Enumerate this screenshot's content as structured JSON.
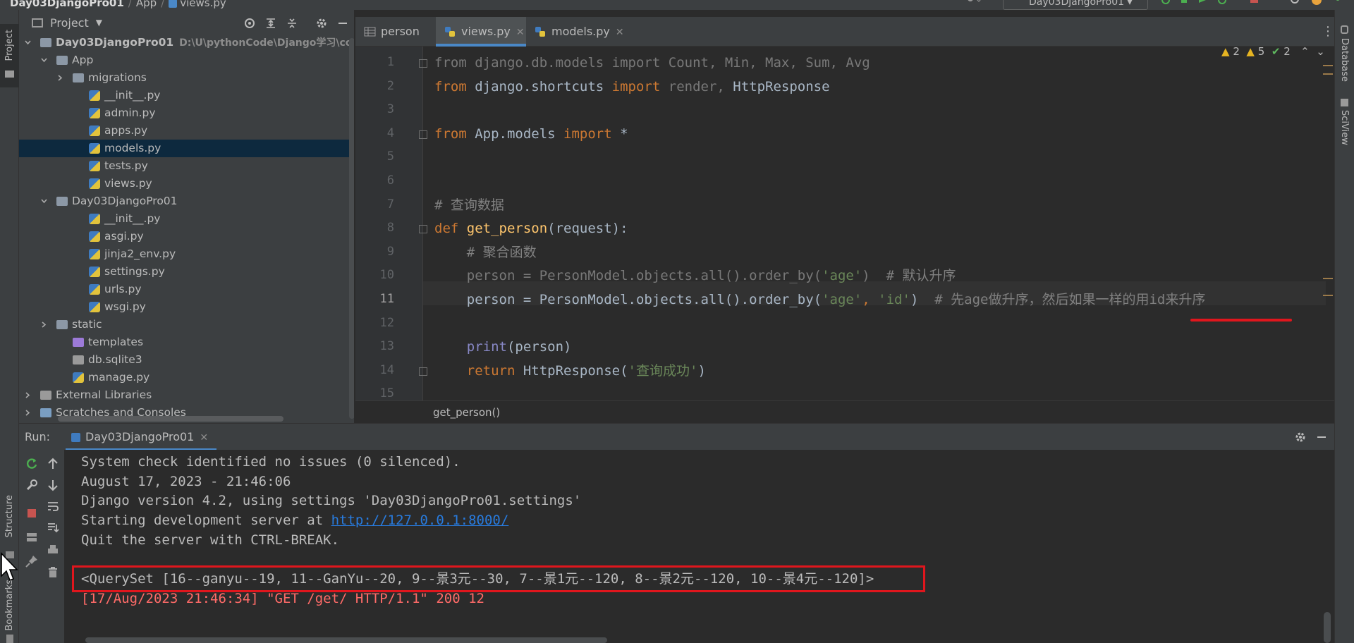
{
  "navbar": {
    "project": "Day03DjangoPro01",
    "folder": "App",
    "file": "views.py",
    "run_config": "Day03DjangoPro01"
  },
  "left_stripe": {
    "project_tab": "Project",
    "structure_tab": "Structure",
    "bookmarks_tab": "Bookmarks"
  },
  "right_stripe": {
    "database_tab": "Database",
    "sciview_tab": "SciView"
  },
  "project_panel": {
    "title": "Project",
    "tree": [
      {
        "label": "Day03DjangoPro01",
        "path": "D:\\U\\pythonCode\\Django学习\\code\\D",
        "type": "root-folder",
        "depth": 0,
        "expanded": true
      },
      {
        "label": "App",
        "type": "package",
        "depth": 1,
        "expanded": true
      },
      {
        "label": "migrations",
        "type": "package",
        "depth": 2,
        "expanded": false
      },
      {
        "label": "__init__.py",
        "type": "py",
        "depth": 3
      },
      {
        "label": "admin.py",
        "type": "py",
        "depth": 3
      },
      {
        "label": "apps.py",
        "type": "py",
        "depth": 3
      },
      {
        "label": "models.py",
        "type": "py",
        "depth": 3,
        "selected": true
      },
      {
        "label": "tests.py",
        "type": "py",
        "depth": 3
      },
      {
        "label": "views.py",
        "type": "py",
        "depth": 3
      },
      {
        "label": "Day03DjangoPro01",
        "type": "package",
        "depth": 1,
        "expanded": true
      },
      {
        "label": "__init__.py",
        "type": "py",
        "depth": 3
      },
      {
        "label": "asgi.py",
        "type": "py",
        "depth": 3
      },
      {
        "label": "jinja2_env.py",
        "type": "py",
        "depth": 3
      },
      {
        "label": "settings.py",
        "type": "py",
        "depth": 3
      },
      {
        "label": "urls.py",
        "type": "py",
        "depth": 3
      },
      {
        "label": "wsgi.py",
        "type": "py",
        "depth": 3
      },
      {
        "label": "static",
        "type": "folder",
        "depth": 1,
        "expanded": false
      },
      {
        "label": "templates",
        "type": "template-folder",
        "depth": 2
      },
      {
        "label": "db.sqlite3",
        "type": "db",
        "depth": 2
      },
      {
        "label": "manage.py",
        "type": "py",
        "depth": 2
      },
      {
        "label": "External Libraries",
        "type": "libs",
        "depth": 0,
        "expanded": false
      },
      {
        "label": "Scratches and Consoles",
        "type": "scratch",
        "depth": 0,
        "expanded": false
      }
    ]
  },
  "editor": {
    "tabs": [
      {
        "label": "person",
        "active": false,
        "closable": false
      },
      {
        "label": "views.py",
        "active": true,
        "closable": true
      },
      {
        "label": "models.py",
        "active": false,
        "closable": true
      }
    ],
    "inspections": {
      "warnings": "2",
      "weak_warnings": "5",
      "ok": "2"
    },
    "current_line": 11,
    "breadcrumb": "get_person()",
    "lines": [
      {
        "n": "1",
        "tokens": [
          [
            "dim",
            "from"
          ],
          [
            "dim",
            " django.db.models "
          ],
          [
            "dim",
            "import"
          ],
          [
            "dim",
            " Count, Min, Max, Sum, Avg"
          ]
        ]
      },
      {
        "n": "2",
        "tokens": [
          [
            "kw",
            "from"
          ],
          [
            "",
            " django.shortcuts "
          ],
          [
            "kw",
            "import"
          ],
          [
            "dim",
            " render, "
          ],
          [
            "",
            "HttpResponse"
          ]
        ]
      },
      {
        "n": "3",
        "tokens": []
      },
      {
        "n": "4",
        "tokens": [
          [
            "kw",
            "from"
          ],
          [
            "",
            " App.models "
          ],
          [
            "kw",
            "import"
          ],
          [
            "",
            " *"
          ]
        ]
      },
      {
        "n": "5",
        "tokens": []
      },
      {
        "n": "6",
        "tokens": []
      },
      {
        "n": "7",
        "tokens": [
          [
            "cm",
            "# 查询数据"
          ]
        ]
      },
      {
        "n": "8",
        "tokens": [
          [
            "kw",
            "def"
          ],
          [
            "",
            " "
          ],
          [
            "fn",
            "get_person"
          ],
          [
            "",
            "(request):"
          ]
        ]
      },
      {
        "n": "9",
        "tokens": [
          [
            "cm",
            "    # 聚合函数"
          ]
        ]
      },
      {
        "n": "10",
        "tokens": [
          [
            "dim",
            "    person = PersonModel.objects.all().order_by("
          ],
          [
            "str",
            "'age'"
          ],
          [
            "dim",
            ")  "
          ],
          [
            "cm",
            "# 默认升序"
          ]
        ]
      },
      {
        "n": "11",
        "tokens": [
          [
            "",
            "    person = PersonModel.objects.all().order_by("
          ],
          [
            "str",
            "'age'"
          ],
          [
            "kw",
            ", "
          ],
          [
            "str",
            "'id'"
          ],
          [
            "",
            ")  "
          ],
          [
            "cm",
            "# 先age做升序，然后如果一样的用id来升序"
          ]
        ]
      },
      {
        "n": "12",
        "tokens": []
      },
      {
        "n": "13",
        "tokens": [
          [
            "bi",
            "    print"
          ],
          [
            "",
            "(person)"
          ]
        ]
      },
      {
        "n": "14",
        "tokens": [
          [
            "kw",
            "    return"
          ],
          [
            "",
            " HttpResponse("
          ],
          [
            "str",
            "'查询成功'"
          ],
          [
            "",
            ")"
          ]
        ]
      },
      {
        "n": "15",
        "tokens": []
      }
    ]
  },
  "run_panel": {
    "label": "Run:",
    "tab": "Day03DjangoPro01",
    "output": [
      {
        "text": "System check identified no issues (0 silenced).",
        "kind": "normal"
      },
      {
        "text": "August 17, 2023 - 21:46:06",
        "kind": "normal"
      },
      {
        "text": "Django version 4.2, using settings 'Day03DjangoPro01.settings'",
        "kind": "normal"
      },
      {
        "text": "Starting development server at ",
        "link": "http://127.0.0.1:8000/",
        "kind": "link-line"
      },
      {
        "text": "Quit the server with CTRL-BREAK.",
        "kind": "normal"
      },
      {
        "text": "",
        "kind": "normal"
      },
      {
        "text": "<QuerySet [16--ganyu--19, 11--GanYu--20, 9--景3元--30, 7--景1元--120, 8--景2元--120, 10--景4元--120]>",
        "kind": "normal"
      },
      {
        "text": "[17/Aug/2023 21:46:34] \"GET /get/ HTTP/1.1\" 200 12",
        "kind": "err"
      }
    ]
  },
  "colors": {
    "accent": "#4a88c7",
    "highlight_red": "#e0161d",
    "keyword": "#cc7832",
    "string": "#6a8759",
    "function": "#ffc66d",
    "comment": "#808080"
  }
}
